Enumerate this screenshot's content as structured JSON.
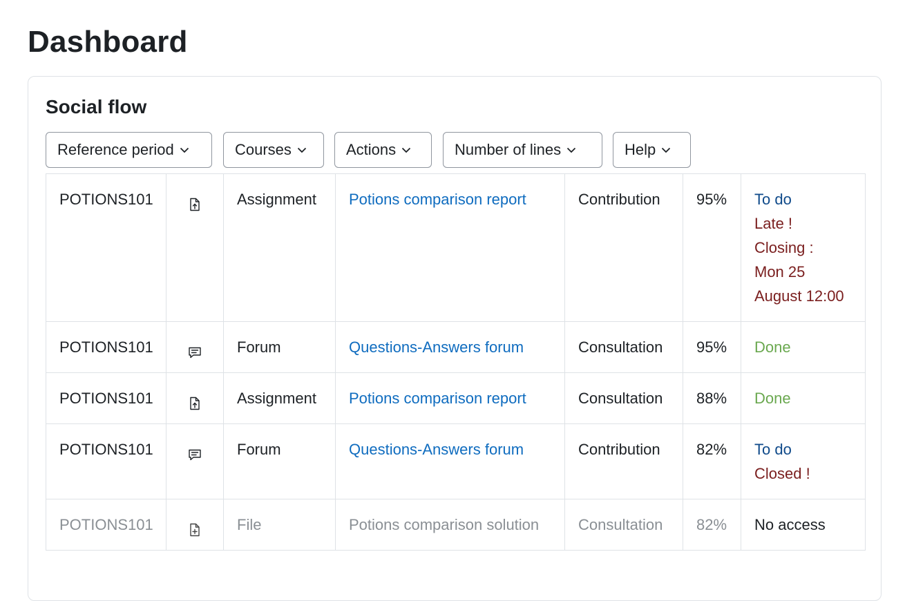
{
  "page": {
    "title": "Dashboard"
  },
  "block": {
    "title": "Social flow",
    "filters": [
      {
        "label": "Reference period"
      },
      {
        "label": "Courses"
      },
      {
        "label": "Actions"
      },
      {
        "label": "Number of lines"
      },
      {
        "label": "Help"
      }
    ]
  },
  "rows": [
    {
      "course": "POTIONS101",
      "icon": "assignment-upload-icon",
      "type": "Assignment",
      "activity": "Potions comparison report",
      "action": "Contribution",
      "percent": "95%",
      "status": [
        "To do",
        "Late !",
        "Closing :",
        "Mon 25",
        "August 12:00"
      ],
      "disabled": false
    },
    {
      "course": "POTIONS101",
      "icon": "forum-icon",
      "type": "Forum",
      "activity": "Questions-Answers forum",
      "action": "Consultation",
      "percent": "95%",
      "status": [
        "Done"
      ],
      "disabled": false
    },
    {
      "course": "POTIONS101",
      "icon": "assignment-upload-icon",
      "type": "Assignment",
      "activity": "Potions comparison report",
      "action": "Consultation",
      "percent": "88%",
      "status": [
        "Done"
      ],
      "disabled": false
    },
    {
      "course": "POTIONS101",
      "icon": "forum-icon",
      "type": "Forum",
      "activity": "Questions-Answers forum",
      "action": "Contribution",
      "percent": "82%",
      "status": [
        "To do",
        "Closed !"
      ],
      "disabled": false
    },
    {
      "course": "POTIONS101",
      "icon": "file-icon",
      "type": "File",
      "activity": "Potions comparison solution",
      "action": "Consultation",
      "percent": "82%",
      "status": [
        "No access"
      ],
      "disabled": true
    }
  ],
  "colors": {
    "link": "#0f6cbf",
    "todo": "#0f4a8a",
    "late": "#7a1e1e",
    "done": "#6aa84f",
    "dimmed_text": "#8a8f94"
  }
}
